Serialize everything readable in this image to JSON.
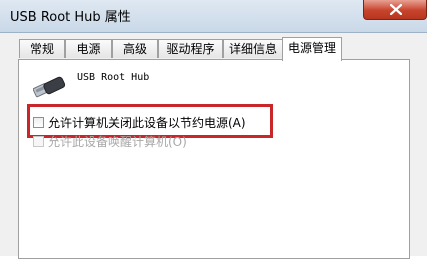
{
  "window": {
    "title": "USB Root Hub 属性"
  },
  "tabs": [
    {
      "label": "常规",
      "active": false
    },
    {
      "label": "电源",
      "active": false
    },
    {
      "label": "高级",
      "active": false
    },
    {
      "label": "驱动程序",
      "active": false
    },
    {
      "label": "详细信息",
      "active": false
    },
    {
      "label": "电源管理",
      "active": true
    }
  ],
  "device": {
    "name": "USB Root Hub",
    "icon": "usb-connector-icon"
  },
  "options": [
    {
      "label": "允许计算机关闭此设备以节约电源(A)",
      "checked": false,
      "enabled": true
    },
    {
      "label": "允许此设备唤醒计算机(O)",
      "checked": false,
      "enabled": false
    }
  ],
  "colors": {
    "highlight_border": "#c9262a",
    "close_button": "#c7432c",
    "titlebar": "#c9d8e8"
  }
}
